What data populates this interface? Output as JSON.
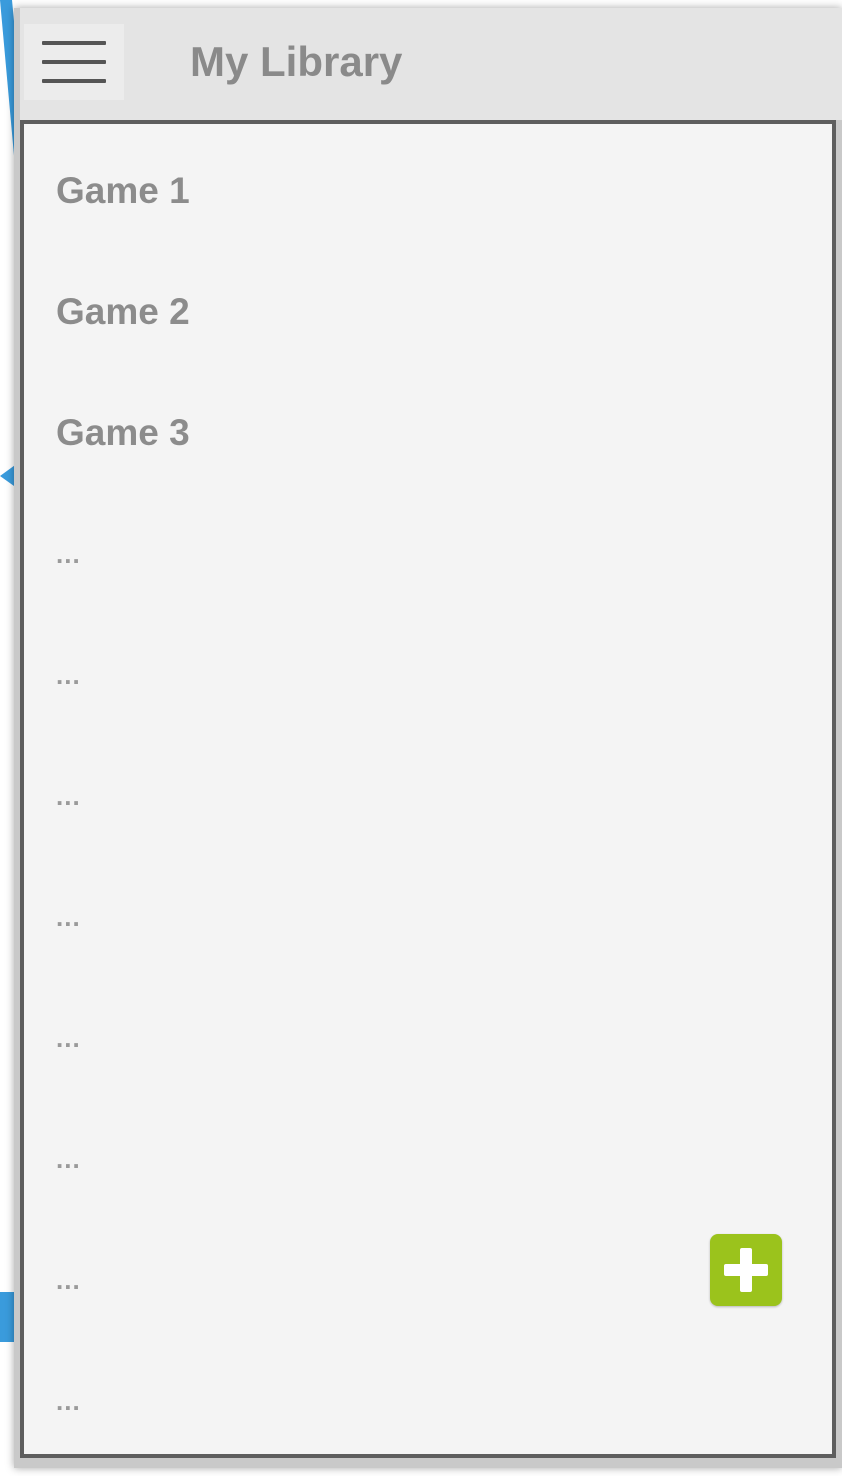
{
  "app_bar": {
    "title": "My Library",
    "menu_icon": "hamburger-menu-icon"
  },
  "library": {
    "items": [
      {
        "label": "Game 1"
      },
      {
        "label": "Game 2"
      },
      {
        "label": "Game 3"
      },
      {
        "label": "..."
      },
      {
        "label": "..."
      },
      {
        "label": "..."
      },
      {
        "label": "..."
      },
      {
        "label": "..."
      },
      {
        "label": "..."
      },
      {
        "label": "..."
      },
      {
        "label": "..."
      }
    ]
  },
  "fab": {
    "icon": "plus-icon",
    "color": "#9bc31c"
  },
  "colors": {
    "app_bar_background": "#e4e4e4",
    "content_background": "#f4f4f4",
    "text": "#8c8c8c",
    "annotation_arrow": "#3a9bdc"
  }
}
